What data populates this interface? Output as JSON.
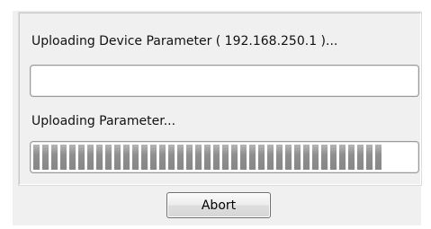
{
  "dialog": {
    "device_label": "Uploading Device Parameter ( 192.168.250.1 )...",
    "device_progress": 0.0,
    "parameter_label": "Uploading Parameter...",
    "parameter_progress": 0.91,
    "abort_label": "Abort"
  }
}
